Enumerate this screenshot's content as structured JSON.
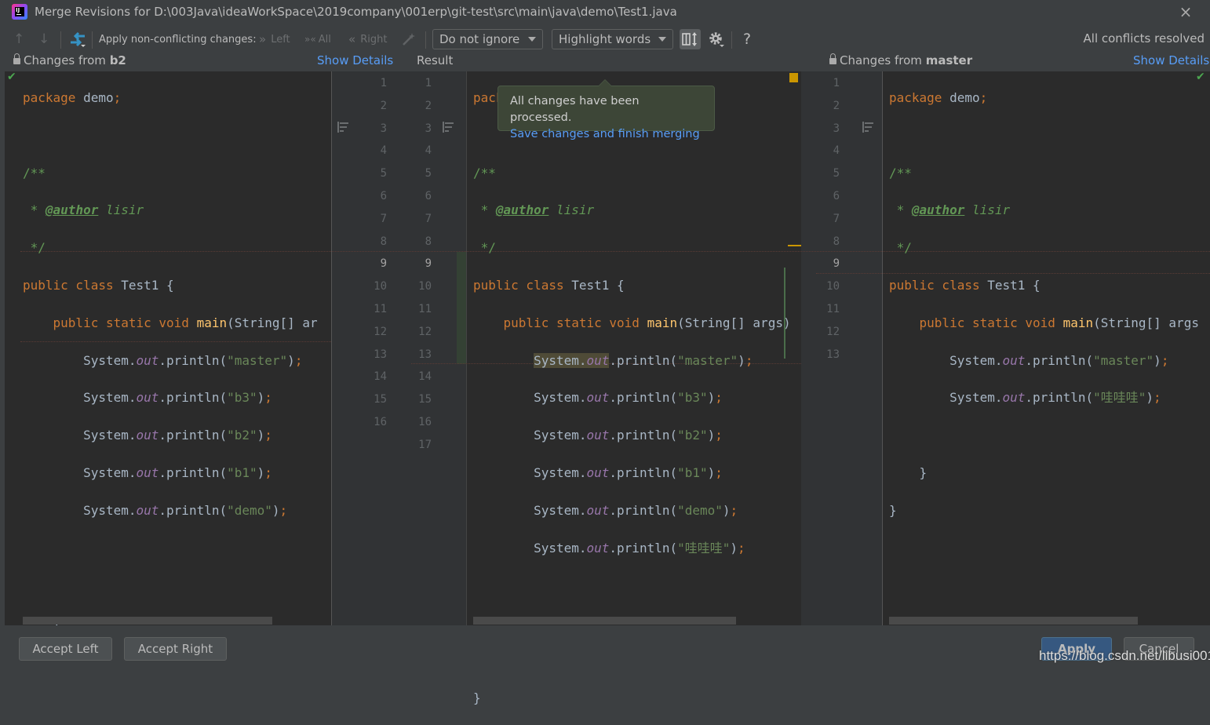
{
  "window": {
    "title": "Merge Revisions for D:\\003Java\\ideaWorkSpace\\2019company\\001erp\\git-test\\src\\main\\java\\demo\\Test1.java",
    "close_icon": "×"
  },
  "toolbar": {
    "prev_icon": "↑",
    "next_icon": "↓",
    "apply_non_conflicting_label": "Apply non-conflicting changes:",
    "left_label": "Left",
    "all_label": "All",
    "right_label": "Right",
    "ignore_select": "Do not ignore",
    "highlight_select": "Highlight words",
    "help_icon": "?",
    "status": "All conflicts resolved"
  },
  "headers": {
    "left_prefix": "Changes from ",
    "left_branch": "b2",
    "left_show_details": "Show Details",
    "center": "Result",
    "right_prefix": "Changes from ",
    "right_branch": "master",
    "right_show_details": "Show Details"
  },
  "tooltip": {
    "message": "All changes have been processed.",
    "link": "Save changes and finish merging"
  },
  "left_line_numbers": [
    "1",
    "2",
    "3",
    "4",
    "5",
    "6",
    "7",
    "8",
    "9",
    "10",
    "11",
    "12",
    "13",
    "14",
    "15",
    "16"
  ],
  "result_line_numbers": [
    "1",
    "2",
    "3",
    "4",
    "5",
    "6",
    "7",
    "8",
    "9",
    "10",
    "11",
    "12",
    "13",
    "14",
    "15",
    "16",
    "17"
  ],
  "right_line_numbers": [
    "1",
    "2",
    "3",
    "4",
    "5",
    "6",
    "7",
    "8",
    "9",
    "10",
    "11",
    "12",
    "13"
  ],
  "left_code": {
    "l1_kw": "package",
    "l1_rest": " demo",
    "l1_semi": ";",
    "l3": "/**",
    "l4_star": " * ",
    "l4_tag": "@author",
    "l4_rest": " lisir",
    "l5": " */",
    "l6_kw": "public class",
    "l6_rest": " Test1 {",
    "l7_kw": "    public static void ",
    "l7_fn": "main",
    "l7_rest": "(String[] ar",
    "print_prefix": "        System.",
    "print_field": "out",
    "print_mid": ".println(",
    "s_master": "\"master\"",
    "s_b3": "\"b3\"",
    "s_b2": "\"b2\"",
    "s_b1": "\"b1\"",
    "s_demo": "\"demo\"",
    "close_paren": ")",
    "semi": ";",
    "l14": "    }",
    "l15": "}"
  },
  "result_code": {
    "l7_rest": "(String[] args)",
    "s_wawawa": "\"哇哇哇\""
  },
  "right_code": {
    "l7_rest": "(String[] args"
  },
  "buttons": {
    "accept_left": "Accept Left",
    "accept_right": "Accept Right",
    "apply": "Apply",
    "cancel": "Cancel"
  },
  "watermark": "https://blog.csdn.net/libusi001"
}
